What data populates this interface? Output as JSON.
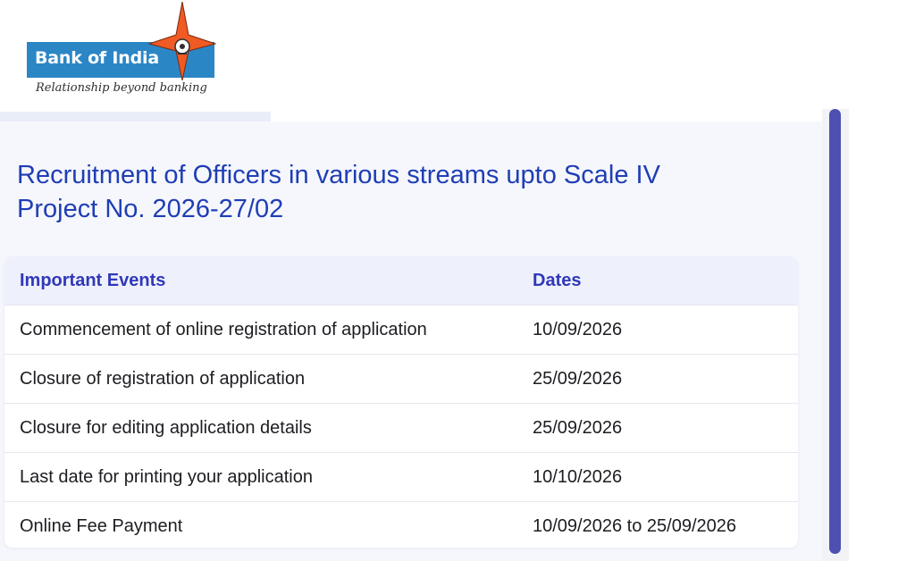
{
  "brand": {
    "name": "Bank of India",
    "tagline": "Relationship beyond banking",
    "colors": {
      "box": "#2b86c6",
      "star": "#f05a23"
    }
  },
  "title": {
    "line1": "Recruitment of Officers in various streams upto Scale IV",
    "line2": "Project No. 2026-27/02"
  },
  "table": {
    "headers": [
      "Important Events",
      "Dates"
    ],
    "rows": [
      [
        "Commencement of online registration of application",
        "10/09/2026"
      ],
      [
        "Closure of registration of application",
        "25/09/2026"
      ],
      [
        "Closure for editing application details",
        "25/09/2026"
      ],
      [
        "Last date for printing your application",
        "10/10/2026"
      ],
      [
        "Online Fee Payment",
        "10/09/2026 to 25/09/2026"
      ]
    ]
  },
  "colors": {
    "title": "#1f3eb5",
    "header_text": "#3138b8",
    "header_bg": "#eef1fc",
    "scrollbar": "#4d4fb1"
  }
}
